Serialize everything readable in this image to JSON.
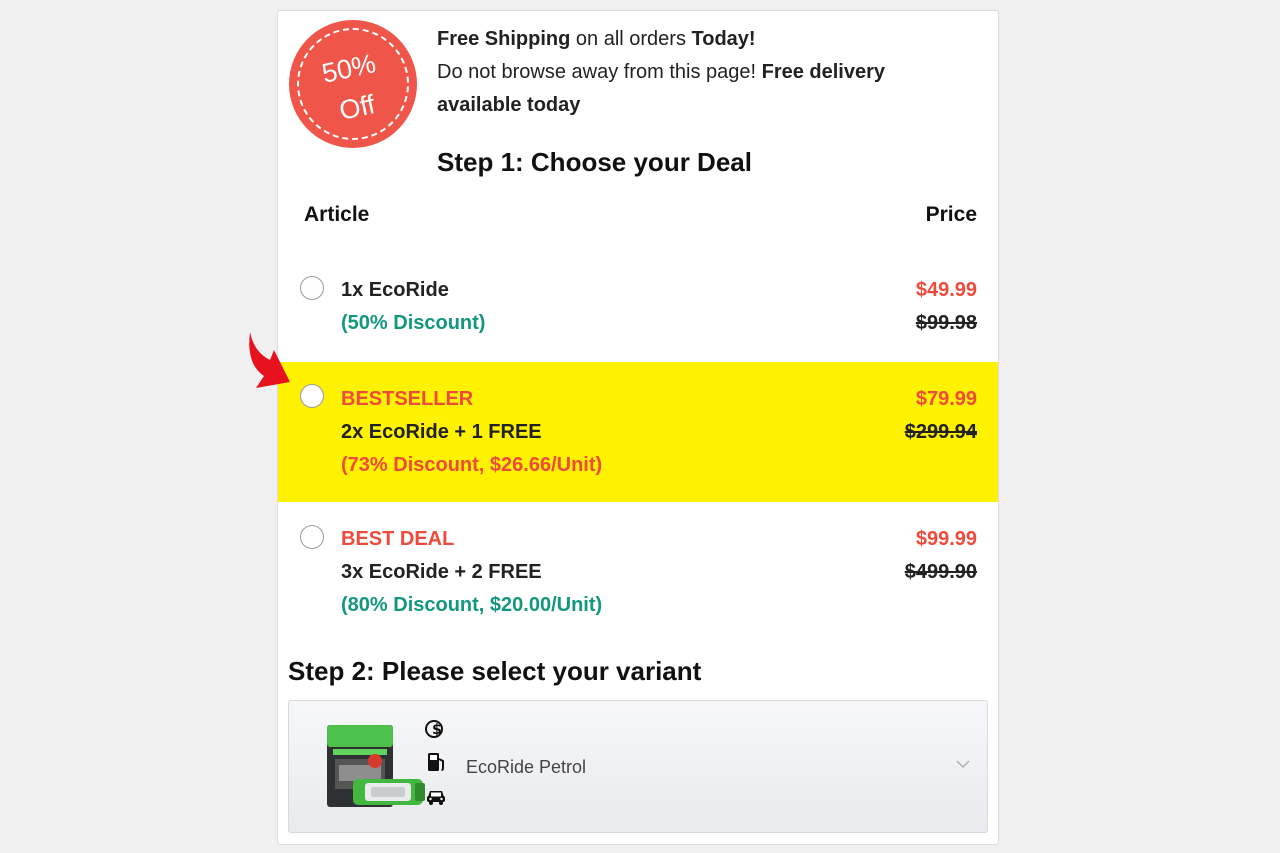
{
  "badge": {
    "text": "50%\nOff",
    "color": "#ef5548"
  },
  "promo": {
    "line1_bold_a": "Free Shipping",
    "line1_mid": " on all orders ",
    "line1_bold_b": "Today!",
    "line2_plain": "Do not browse away from this page! ",
    "line2_bold": "Free delivery available today"
  },
  "step1": {
    "title": "Step 1: Choose your Deal"
  },
  "columns": {
    "article": "Article",
    "price": "Price"
  },
  "deals": [
    {
      "tag": "",
      "name": "1x EcoRide",
      "discount": "(50% Discount)",
      "price": "$49.99",
      "old_price": "$99.98",
      "highlighted": false
    },
    {
      "tag": "BESTSELLER",
      "name": "2x EcoRide + 1 FREE",
      "discount": "(73% Discount, $26.66/Unit)",
      "price": "$79.99",
      "old_price": "$299.94",
      "highlighted": true
    },
    {
      "tag": "BEST DEAL",
      "name": "3x EcoRide + 2 FREE",
      "discount": "(80% Discount, $20.00/Unit)",
      "price": "$99.99",
      "old_price": "$499.90",
      "highlighted": false
    }
  ],
  "step2": {
    "title": "Step 2: Please select your variant"
  },
  "variant": {
    "selected": "EcoRide Petrol",
    "icons": [
      "money-icon",
      "fuel-pump-icon",
      "car-icon"
    ]
  },
  "colors": {
    "accent_red": "#ef4b3c",
    "discount_green": "#13977f",
    "highlight_yellow": "#fff200"
  }
}
